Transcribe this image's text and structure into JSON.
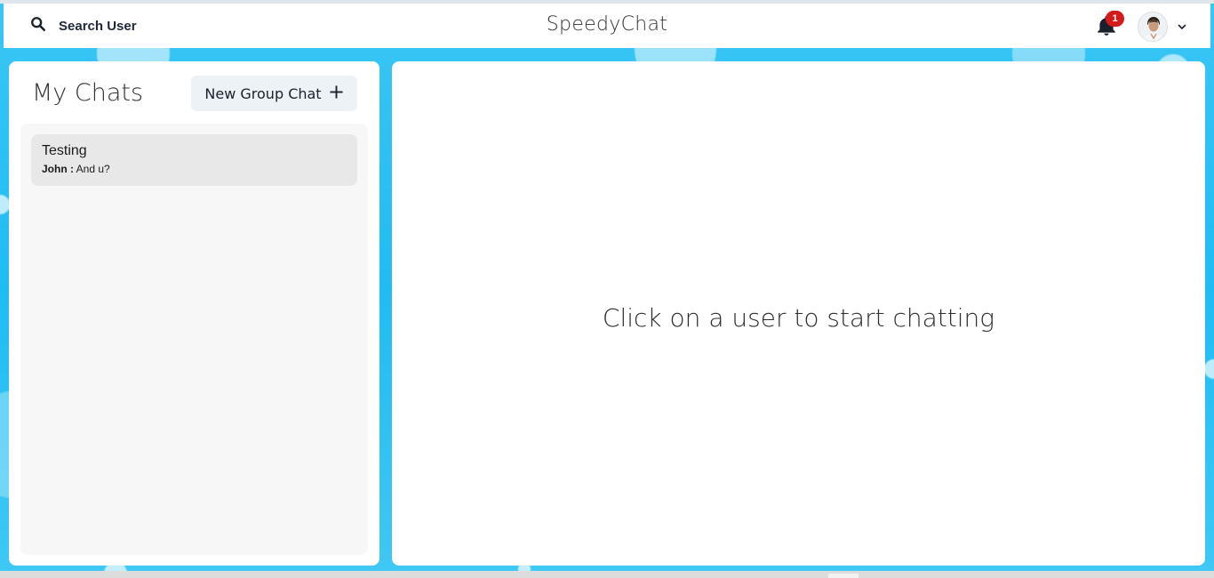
{
  "header": {
    "search_label": "Search User",
    "app_title": "SpeedyChat",
    "notification_count": "1",
    "icons": {
      "search": "search-icon",
      "bell": "bell-icon",
      "chevron": "chevron-down-icon"
    }
  },
  "sidebar": {
    "title": "My Chats",
    "new_group_label": "New Group Chat",
    "chats": [
      {
        "name": "Testing",
        "sender": "John :",
        "message": "And u?"
      }
    ]
  },
  "main": {
    "empty_message": "Click on a user to start chatting"
  },
  "colors": {
    "background": "#2fc4f5",
    "panel": "#ffffff",
    "badge": "#d51a1a",
    "chat_item": "#e8e8e8",
    "button": "#edf2f7"
  }
}
